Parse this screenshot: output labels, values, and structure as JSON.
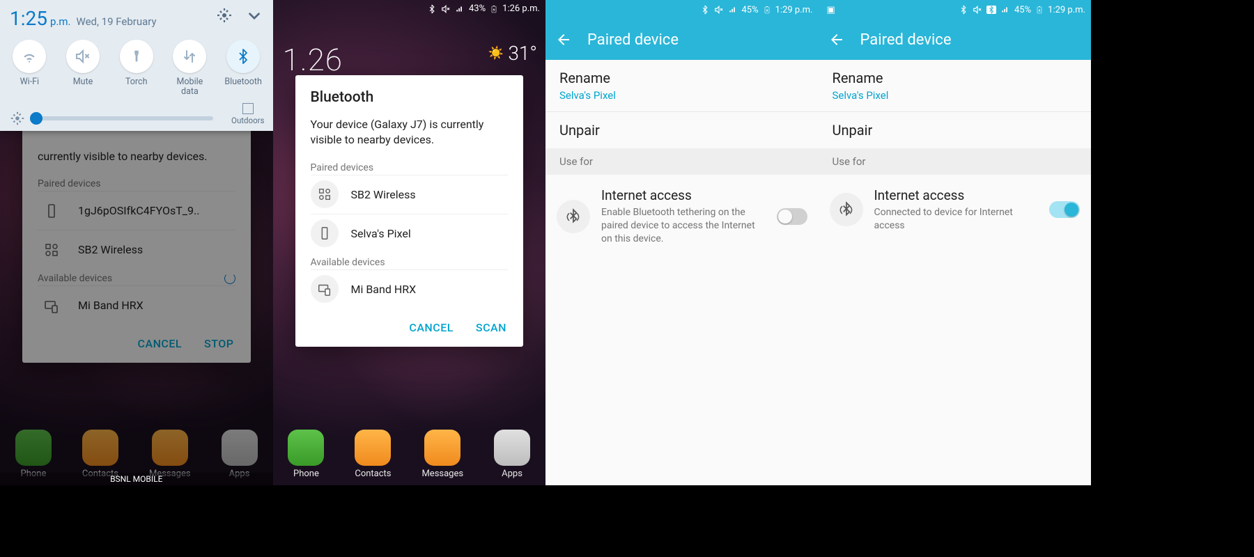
{
  "s1": {
    "qs": {
      "time": "1:25",
      "ampm": "p.m.",
      "date": "Wed, 19 February",
      "toggles": [
        "Wi-Fi",
        "Mute",
        "Torch",
        "Mobile\ndata",
        "Bluetooth"
      ],
      "outdoors": "Outdoors"
    },
    "card": {
      "visible_partial": "currently visible to nearby devices.",
      "paired_label": "Paired devices",
      "paired": [
        "1gJ6pOSIfkC4FYOsT_9..",
        "SB2 Wireless"
      ],
      "avail_label": "Available devices",
      "avail": [
        "Mi Band HRX"
      ],
      "btn1": "CANCEL",
      "btn2": "STOP"
    },
    "bottom": [
      "Phone",
      "Contacts",
      "Messages",
      "Apps"
    ],
    "carrier": "BSNL MOBILE"
  },
  "s2": {
    "status": {
      "pct": "43%",
      "time": "1:26 p.m."
    },
    "weather": "31°",
    "clock": "1.26",
    "card": {
      "title": "Bluetooth",
      "desc": "Your device (Galaxy J7) is currently visible to nearby devices.",
      "paired_label": "Paired devices",
      "paired": [
        "SB2 Wireless",
        "Selva's Pixel"
      ],
      "avail_label": "Available devices",
      "avail": [
        "Mi Band HRX"
      ],
      "btn1": "CANCEL",
      "btn2": "SCAN"
    },
    "bottom": [
      "Phone",
      "Contacts",
      "Messages",
      "Apps"
    ]
  },
  "s3": {
    "status": {
      "pct": "45%",
      "time": "1:29 p.m."
    },
    "title": "Paired device",
    "rename": "Rename",
    "devname": "Selva's Pixel",
    "unpair": "Unpair",
    "usefor": "Use for",
    "ia_title": "Internet access",
    "ia_sub": "Enable Bluetooth tethering on the paired device to access the Internet on this device.",
    "switch_on": false
  },
  "s4": {
    "status": {
      "pct": "45%",
      "time": "1:29 p.m."
    },
    "title": "Paired device",
    "rename": "Rename",
    "devname": "Selva's Pixel",
    "unpair": "Unpair",
    "usefor": "Use for",
    "ia_title": "Internet access",
    "ia_sub": "Connected to device for Internet access",
    "switch_on": true
  }
}
